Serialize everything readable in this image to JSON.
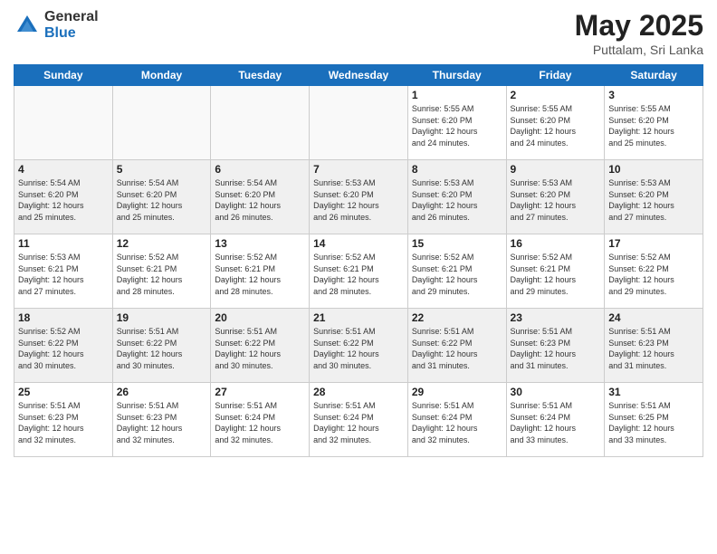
{
  "header": {
    "logo_general": "General",
    "logo_blue": "Blue",
    "month": "May 2025",
    "location": "Puttalam, Sri Lanka"
  },
  "days_of_week": [
    "Sunday",
    "Monday",
    "Tuesday",
    "Wednesday",
    "Thursday",
    "Friday",
    "Saturday"
  ],
  "weeks": [
    [
      {
        "day": "",
        "info": ""
      },
      {
        "day": "",
        "info": ""
      },
      {
        "day": "",
        "info": ""
      },
      {
        "day": "",
        "info": ""
      },
      {
        "day": "1",
        "info": "Sunrise: 5:55 AM\nSunset: 6:20 PM\nDaylight: 12 hours\nand 24 minutes."
      },
      {
        "day": "2",
        "info": "Sunrise: 5:55 AM\nSunset: 6:20 PM\nDaylight: 12 hours\nand 24 minutes."
      },
      {
        "day": "3",
        "info": "Sunrise: 5:55 AM\nSunset: 6:20 PM\nDaylight: 12 hours\nand 25 minutes."
      }
    ],
    [
      {
        "day": "4",
        "info": "Sunrise: 5:54 AM\nSunset: 6:20 PM\nDaylight: 12 hours\nand 25 minutes."
      },
      {
        "day": "5",
        "info": "Sunrise: 5:54 AM\nSunset: 6:20 PM\nDaylight: 12 hours\nand 25 minutes."
      },
      {
        "day": "6",
        "info": "Sunrise: 5:54 AM\nSunset: 6:20 PM\nDaylight: 12 hours\nand 26 minutes."
      },
      {
        "day": "7",
        "info": "Sunrise: 5:53 AM\nSunset: 6:20 PM\nDaylight: 12 hours\nand 26 minutes."
      },
      {
        "day": "8",
        "info": "Sunrise: 5:53 AM\nSunset: 6:20 PM\nDaylight: 12 hours\nand 26 minutes."
      },
      {
        "day": "9",
        "info": "Sunrise: 5:53 AM\nSunset: 6:20 PM\nDaylight: 12 hours\nand 27 minutes."
      },
      {
        "day": "10",
        "info": "Sunrise: 5:53 AM\nSunset: 6:20 PM\nDaylight: 12 hours\nand 27 minutes."
      }
    ],
    [
      {
        "day": "11",
        "info": "Sunrise: 5:53 AM\nSunset: 6:21 PM\nDaylight: 12 hours\nand 27 minutes."
      },
      {
        "day": "12",
        "info": "Sunrise: 5:52 AM\nSunset: 6:21 PM\nDaylight: 12 hours\nand 28 minutes."
      },
      {
        "day": "13",
        "info": "Sunrise: 5:52 AM\nSunset: 6:21 PM\nDaylight: 12 hours\nand 28 minutes."
      },
      {
        "day": "14",
        "info": "Sunrise: 5:52 AM\nSunset: 6:21 PM\nDaylight: 12 hours\nand 28 minutes."
      },
      {
        "day": "15",
        "info": "Sunrise: 5:52 AM\nSunset: 6:21 PM\nDaylight: 12 hours\nand 29 minutes."
      },
      {
        "day": "16",
        "info": "Sunrise: 5:52 AM\nSunset: 6:21 PM\nDaylight: 12 hours\nand 29 minutes."
      },
      {
        "day": "17",
        "info": "Sunrise: 5:52 AM\nSunset: 6:22 PM\nDaylight: 12 hours\nand 29 minutes."
      }
    ],
    [
      {
        "day": "18",
        "info": "Sunrise: 5:52 AM\nSunset: 6:22 PM\nDaylight: 12 hours\nand 30 minutes."
      },
      {
        "day": "19",
        "info": "Sunrise: 5:51 AM\nSunset: 6:22 PM\nDaylight: 12 hours\nand 30 minutes."
      },
      {
        "day": "20",
        "info": "Sunrise: 5:51 AM\nSunset: 6:22 PM\nDaylight: 12 hours\nand 30 minutes."
      },
      {
        "day": "21",
        "info": "Sunrise: 5:51 AM\nSunset: 6:22 PM\nDaylight: 12 hours\nand 30 minutes."
      },
      {
        "day": "22",
        "info": "Sunrise: 5:51 AM\nSunset: 6:22 PM\nDaylight: 12 hours\nand 31 minutes."
      },
      {
        "day": "23",
        "info": "Sunrise: 5:51 AM\nSunset: 6:23 PM\nDaylight: 12 hours\nand 31 minutes."
      },
      {
        "day": "24",
        "info": "Sunrise: 5:51 AM\nSunset: 6:23 PM\nDaylight: 12 hours\nand 31 minutes."
      }
    ],
    [
      {
        "day": "25",
        "info": "Sunrise: 5:51 AM\nSunset: 6:23 PM\nDaylight: 12 hours\nand 32 minutes."
      },
      {
        "day": "26",
        "info": "Sunrise: 5:51 AM\nSunset: 6:23 PM\nDaylight: 12 hours\nand 32 minutes."
      },
      {
        "day": "27",
        "info": "Sunrise: 5:51 AM\nSunset: 6:24 PM\nDaylight: 12 hours\nand 32 minutes."
      },
      {
        "day": "28",
        "info": "Sunrise: 5:51 AM\nSunset: 6:24 PM\nDaylight: 12 hours\nand 32 minutes."
      },
      {
        "day": "29",
        "info": "Sunrise: 5:51 AM\nSunset: 6:24 PM\nDaylight: 12 hours\nand 32 minutes."
      },
      {
        "day": "30",
        "info": "Sunrise: 5:51 AM\nSunset: 6:24 PM\nDaylight: 12 hours\nand 33 minutes."
      },
      {
        "day": "31",
        "info": "Sunrise: 5:51 AM\nSunset: 6:25 PM\nDaylight: 12 hours\nand 33 minutes."
      }
    ]
  ]
}
